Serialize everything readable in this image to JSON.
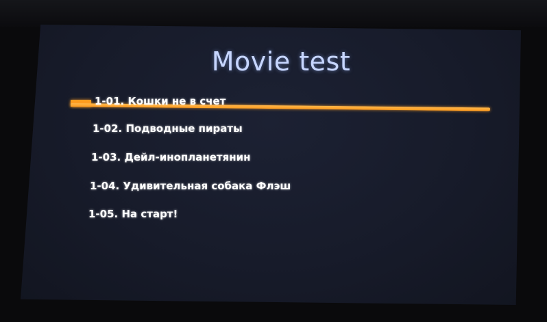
{
  "screen": {
    "title": "Movie test",
    "accent_color": "#ff9c1f",
    "selected_index": 0
  },
  "menu": {
    "items": [
      {
        "label": "1-01. Кошки не в счет"
      },
      {
        "label": "1-02. Подводные пираты"
      },
      {
        "label": "1-03. Дейл-инопланетянин"
      },
      {
        "label": "1-04. Удивительная собака Флэш"
      },
      {
        "label": "1-05. На старт!"
      }
    ]
  }
}
